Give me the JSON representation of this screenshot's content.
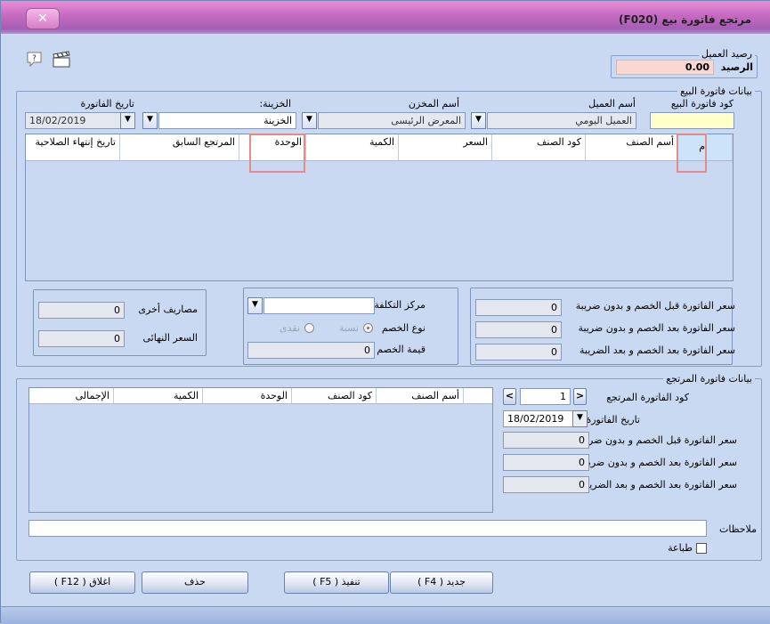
{
  "window": {
    "title": "مرتجع فاتورة بيع  (F020)",
    "close_glyph": "✕"
  },
  "toolbar": {
    "help_icon": "help-icon",
    "clapper_icon": "clapperboard-icon"
  },
  "balance": {
    "group_title": "رصيد العميل",
    "label": "الرصيد",
    "value": "0.00"
  },
  "invoice": {
    "group_title": "بيانات فاتورة البيع",
    "code_label": "كود فاتورة البيع",
    "code_value": "",
    "customer_label": "أسم العميل",
    "customer_value": "العميل اليومي",
    "store_label": "أسم المخزن",
    "store_value": "المعرض الرئيسى",
    "treasury_label": "الخزينة:",
    "treasury_value": "الخزينة",
    "date_label": "تاريخ الفاتورة",
    "date_value": "18/02/2019"
  },
  "items_grid": {
    "columns": [
      "م",
      "أسم الصنف",
      "كود الصنف",
      "السعر",
      "الكمية",
      "الوحدة",
      "المرتجع السابق",
      "تاريخ إنتهاء الصلاحية"
    ]
  },
  "totals": {
    "before_discount_label": "سعر الفاتورة قبل الخصم و بدون ضريبة",
    "before_discount_value": "0",
    "after_discount_label": "سعر الفاتورة بعد الخصم و بدون ضريبة",
    "after_discount_value": "0",
    "after_tax_label": "سعر الفاتورة بعد الخصم و بعد الضريبة",
    "after_tax_value": "0"
  },
  "discount": {
    "cost_center_label": "مركز التكلفة",
    "cost_center_value": "",
    "type_label": "نوع الخصم",
    "type_percent": "نسبة",
    "type_cash": "نقدى",
    "value_label": "قيمة الخصم",
    "value": "0"
  },
  "expenses": {
    "other_label": "مصاريف أخرى",
    "other_value": "0",
    "final_label": "السعر النهائى",
    "final_value": "0"
  },
  "return_invoice": {
    "group_title": "بيانات فاتورة المرتجع",
    "code_label": "كود الفاتورة المرتجع",
    "code_value": "1",
    "date_label": "تاريخ الفاتورة",
    "date_value": "18/02/2019",
    "before_discount_label": "سعر الفاتورة قبل الخصم و بدون ضريبة",
    "before_discount_value": "0",
    "after_discount_label": "سعر الفاتورة بعد الخصم و بدون ضريبة",
    "after_discount_value": "0",
    "after_tax_label": "سعر الفاتورة بعد الخصم و بعد الضريبة",
    "after_tax_value": "0",
    "prev_glyph": "<",
    "next_glyph": ">"
  },
  "return_grid": {
    "columns": [
      "أسم الصنف",
      "كود الصنف",
      "الوحدة",
      "الكمية",
      "الإجمالى"
    ]
  },
  "notes": {
    "label": "ملاحظات",
    "value": ""
  },
  "print": {
    "label": "طباعة",
    "checked": false
  },
  "buttons": {
    "new": "جديد ( F4 )",
    "execute": "تنفيذ ( F5 )",
    "delete": "حذف",
    "close": "اغلاق ( F12 )"
  },
  "colors": {
    "background": "#c9d9f2",
    "code_field_yellow": "#ffffc8",
    "balance_pink": "#f9d7d2",
    "highlight_red": "#e88a8a"
  }
}
